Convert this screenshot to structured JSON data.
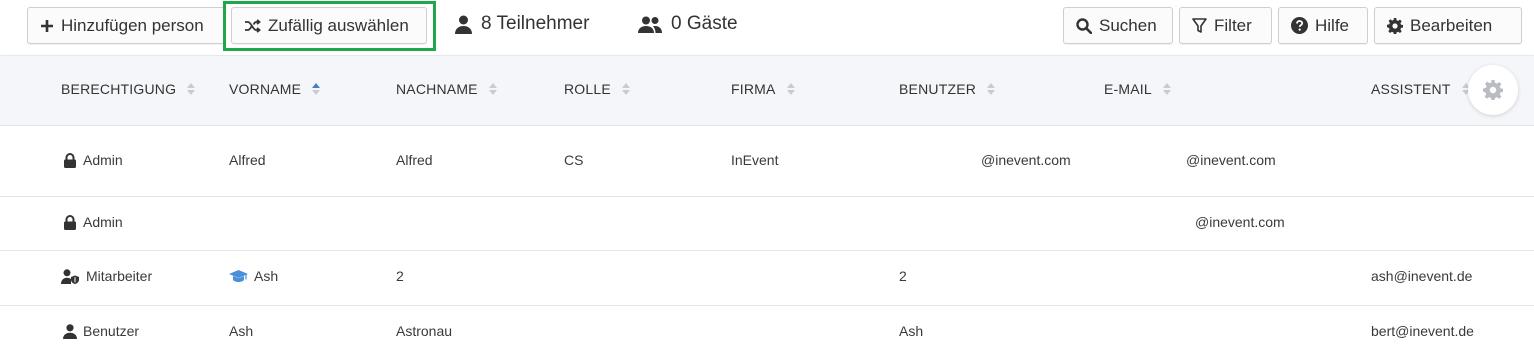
{
  "toolbar": {
    "add_label": "Hinzufügen person",
    "random_label": "Zufällig auswählen",
    "participants_label": "8 Teilnehmer",
    "guests_label": "0 Gäste",
    "search_label": "Suchen",
    "filter_label": "Filter",
    "help_label": "Hilfe",
    "edit_label": "Bearbeiten"
  },
  "table": {
    "columns": [
      "BERECHTIGUNG",
      "VORNAME",
      "NACHNAME",
      "ROLLE",
      "FIRMA",
      "BENUTZER",
      "E-MAIL",
      "ASSISTENT"
    ],
    "sorted_column": "VORNAME",
    "rows": [
      {
        "permission": "Admin",
        "permission_icon": "lock-icon",
        "first_name": "Alfred",
        "first_icon": "",
        "last_name": "Alfred",
        "role": "CS",
        "company": "InEvent",
        "user": "@inevent.com",
        "email": "@inevent.com",
        "assistant": ""
      },
      {
        "permission": "Admin",
        "permission_icon": "lock-icon",
        "first_name": "",
        "first_icon": "",
        "last_name": "",
        "role": "",
        "company": "",
        "user": "",
        "email": "@inevent.com",
        "assistant": ""
      },
      {
        "permission": "Mitarbeiter",
        "permission_icon": "user-shield-icon",
        "first_name": "Ash",
        "first_icon": "graduation-cap-icon",
        "last_name": "2",
        "role": "",
        "company": "",
        "user": "2",
        "email": "",
        "assistant": "ash@inevent.de"
      },
      {
        "permission": "Benutzer",
        "permission_icon": "user-icon",
        "first_name": "Ash",
        "first_icon": "",
        "last_name": "Astronau",
        "role": "",
        "company": "",
        "user": "Ash",
        "email": "",
        "assistant": "bert@inevent.de"
      }
    ]
  },
  "colors": {
    "highlight": "#1fa84a",
    "sort_active": "#4a7ec4",
    "graduation_cap": "#4a90d9"
  }
}
